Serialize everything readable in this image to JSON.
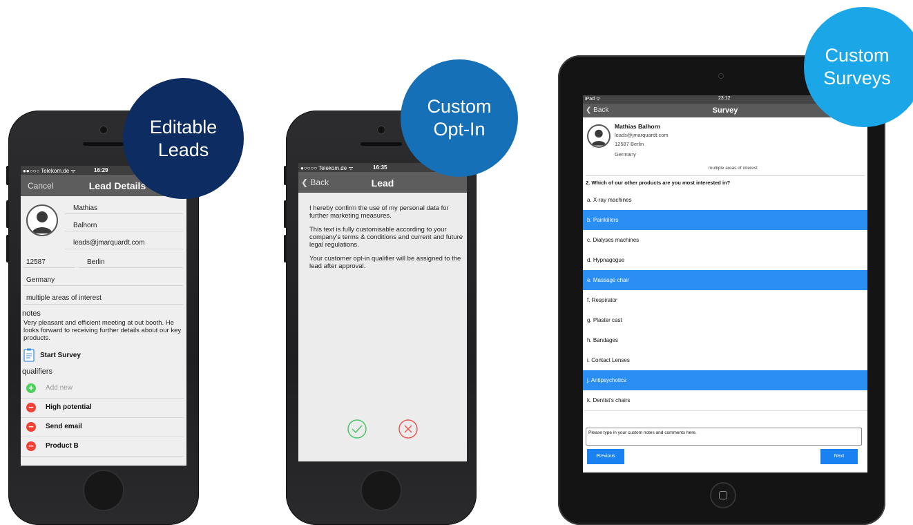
{
  "bubbles": {
    "editable": {
      "line1": "Editable",
      "line2": "Leads",
      "color": "#0d2c62"
    },
    "optin": {
      "line1": "Custom",
      "line2": "Opt-In",
      "color": "#1670b7"
    },
    "surveys": {
      "line1": "Custom",
      "line2": "Surveys",
      "color": "#1ba6e8"
    }
  },
  "phone1": {
    "status": {
      "carrier": "●●○○○ Telekom.de ᯤ",
      "time": "16:29"
    },
    "nav": {
      "cancel": "Cancel",
      "title": "Lead Details"
    },
    "first_name": "Mathias",
    "last_name": "Balhorn",
    "email": "leads@jmarquardt.com",
    "zip": "12587",
    "city": "Berlin",
    "country": "Germany",
    "interest": "multiple areas of interest",
    "notes_label": "notes",
    "notes_text": "Very pleasant and efficient meeting at out booth. He looks forward to receiving further details about our key products.",
    "start_survey": "Start Survey",
    "qualifiers_label": "qualifiers",
    "add_new": "Add new",
    "qualifiers": [
      "High potential",
      "Send email",
      "Product B"
    ]
  },
  "phone2": {
    "status": {
      "carrier": "●○○○○ Telekom.de ᯤ",
      "time": "16:35"
    },
    "nav": {
      "back": "Back",
      "title": "Lead"
    },
    "para1": "I hereby confirm the use of my personal data for further marketing measures.",
    "para2": "This text is fully customisable according to your company's terms & conditions and current and future legal regulations.",
    "para3": "Your customer opt-in qualifier will be assigned to the lead after approval.",
    "accept_color": "#4cc46a",
    "decline_color": "#e85a55"
  },
  "tablet": {
    "status": {
      "device": "iPad ᯤ",
      "time": "23:12"
    },
    "nav": {
      "back": "Back",
      "title": "Survey"
    },
    "name": "Mathias Balhorn",
    "email": "leads@jmarquardt.com",
    "city": "12587 Berlin",
    "country": "Germany",
    "interest": "multiple areas of interest",
    "question": "2. Which of our other products are you most interested in?",
    "options": [
      {
        "label": "a. X-ray machines",
        "selected": false
      },
      {
        "label": "b. Painkillers",
        "selected": true
      },
      {
        "label": "c. Dialyses machines",
        "selected": false
      },
      {
        "label": "d. Hypnagogue",
        "selected": false
      },
      {
        "label": "e. Massage chair",
        "selected": true
      },
      {
        "label": "f. Respirator",
        "selected": false
      },
      {
        "label": "g. Plaster cast",
        "selected": false
      },
      {
        "label": "h. Bandages",
        "selected": false
      },
      {
        "label": "i. Contact Lenses",
        "selected": false
      },
      {
        "label": "j. Antipsychotics",
        "selected": true
      },
      {
        "label": "k. Dentist's chairs",
        "selected": false
      }
    ],
    "notes_placeholder": "Please type in your custom notes and comments here.",
    "previous": "Previous",
    "next": "Next",
    "selected_color": "#2b8ef3"
  }
}
